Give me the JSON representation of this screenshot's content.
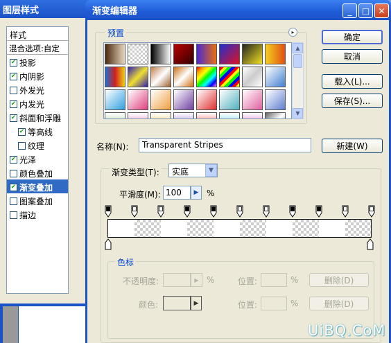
{
  "layer_style": {
    "title": "图层样式",
    "list_header": "样式",
    "blend_options": "混合选项:自定",
    "items": [
      {
        "label": "投影",
        "checked": true,
        "sub": false,
        "selected": false
      },
      {
        "label": "内阴影",
        "checked": true,
        "sub": false,
        "selected": false
      },
      {
        "label": "外发光",
        "checked": false,
        "sub": false,
        "selected": false
      },
      {
        "label": "内发光",
        "checked": true,
        "sub": false,
        "selected": false
      },
      {
        "label": "斜面和浮雕",
        "checked": true,
        "sub": false,
        "selected": false
      },
      {
        "label": "等高线",
        "checked": true,
        "sub": true,
        "selected": false
      },
      {
        "label": "纹理",
        "checked": false,
        "sub": true,
        "selected": false
      },
      {
        "label": "光泽",
        "checked": true,
        "sub": false,
        "selected": false
      },
      {
        "label": "颜色叠加",
        "checked": false,
        "sub": false,
        "selected": false
      },
      {
        "label": "渐变叠加",
        "checked": true,
        "sub": false,
        "selected": true
      },
      {
        "label": "图案叠加",
        "checked": false,
        "sub": false,
        "selected": false
      },
      {
        "label": "描边",
        "checked": false,
        "sub": false,
        "selected": false
      }
    ]
  },
  "dialog": {
    "title": "渐变编辑器",
    "title_buttons": {
      "minimize": "_",
      "maximize": "□",
      "close": "✕"
    },
    "presets_label": "预置",
    "presets_menu_icon": "▸",
    "scroll_up": "▲",
    "scroll_down": "▼",
    "buttons": {
      "ok": "确定",
      "cancel": "取消",
      "load": "载入(L)...",
      "save": "保存(S)..."
    },
    "name_label": "名称(N):",
    "name_value": "Transparent Stripes",
    "new_button": "新建(W)",
    "gradient_type_label": "渐变类型(T):",
    "gradient_type_value": "实底",
    "dropdown_icon": "▼",
    "smoothness_label": "平滑度(M):",
    "smoothness_value": "100",
    "smoothness_arrow": "▶",
    "smoothness_unit": "%",
    "stops": {
      "group_label": "色标",
      "opacity_label": "不透明度:",
      "opacity_unit": "%",
      "opacity_location_label": "位置:",
      "opacity_location_unit": "%",
      "opacity_delete": "删除(D)",
      "color_label": "颜色:",
      "color_location_label": "位置:",
      "color_location_unit": "%",
      "color_delete": "删除(D)"
    }
  },
  "watermark": "UiBQ.CoM",
  "colors": {
    "accent": "#1a52c8",
    "selection": "#316ac5",
    "face": "#ece9d8"
  }
}
